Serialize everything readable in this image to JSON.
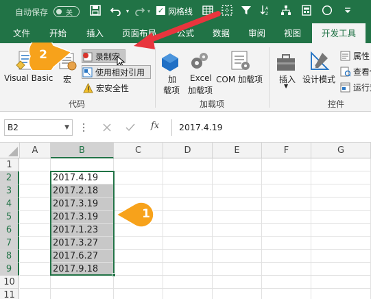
{
  "qat": {
    "autosave_label": "自动保存",
    "autosave_state": "关",
    "gridlines_label": "网格线"
  },
  "tabs": [
    {
      "label": "文件"
    },
    {
      "label": "开始"
    },
    {
      "label": "插入"
    },
    {
      "label": "页面布局"
    },
    {
      "label": "公式"
    },
    {
      "label": "数据"
    },
    {
      "label": "审阅"
    },
    {
      "label": "视图"
    },
    {
      "label": "开发工具",
      "active": true
    }
  ],
  "ribbon": {
    "code_group": {
      "visual_basic": "Visual Basic",
      "macros": "宏",
      "record_macro": "录制宏",
      "relative_ref": "使用相对引用",
      "macro_security": "宏安全性",
      "label": "代码"
    },
    "addins_group": {
      "addins_line1": "加",
      "addins_line2": "载项",
      "excel_addins_line1": "Excel",
      "excel_addins_line2": "加载项",
      "com_addins": "COM 加载项",
      "label": "加载项"
    },
    "controls_group": {
      "insert": "插入",
      "design_mode": "设计模式",
      "properties": "属性",
      "view_code": "查看代",
      "run_dialog": "运行对",
      "label": "控件"
    }
  },
  "formula_bar": {
    "name_box": "B2",
    "fx": "fx",
    "value": "2017.4.19"
  },
  "sheet": {
    "columns": [
      "A",
      "B",
      "C",
      "D",
      "E",
      "F",
      "G"
    ],
    "rows": [
      "1",
      "2",
      "3",
      "4",
      "5",
      "6",
      "7",
      "8",
      "9",
      "10",
      "11"
    ],
    "b_values": [
      "2017.4.19",
      "2017.2.18",
      "2017.3.19",
      "2017.3.19",
      "2017.1.23",
      "2017.3.27",
      "2017.6.27",
      "2017.9.18"
    ]
  },
  "callouts": {
    "one": "1",
    "two": "2"
  },
  "colors": {
    "excel_green": "#217346",
    "callout_orange": "#f7a21b",
    "arrow_red": "#e8353d"
  }
}
